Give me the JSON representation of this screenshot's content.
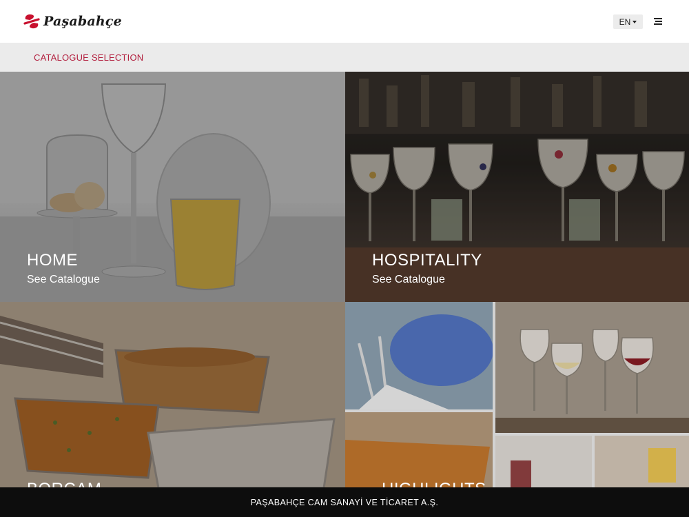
{
  "header": {
    "brand": "Paşabahçe",
    "language": "EN"
  },
  "selection_bar": {
    "label": "CATALOGUE SELECTION"
  },
  "tiles": [
    {
      "title": "HOME",
      "link": "See Catalogue"
    },
    {
      "title": "HOSPITALITY",
      "link": "See Catalogue"
    },
    {
      "title": "BORCAM"
    },
    {
      "title": "HIGHLIGHTS"
    }
  ],
  "footer": {
    "company": "PAŞABAHÇE CAM SANAYİ VE TİCARET A.Ş."
  },
  "colors": {
    "accent": "#b3203f",
    "logo_red": "#c8102e",
    "footer_bg": "#0d0d0d",
    "selection_bg": "#ebebeb"
  },
  "icons": {
    "logo": "pasabahce-logo-mark",
    "language_caret": "caret-down-icon",
    "menu": "hamburger-menu-icon"
  }
}
